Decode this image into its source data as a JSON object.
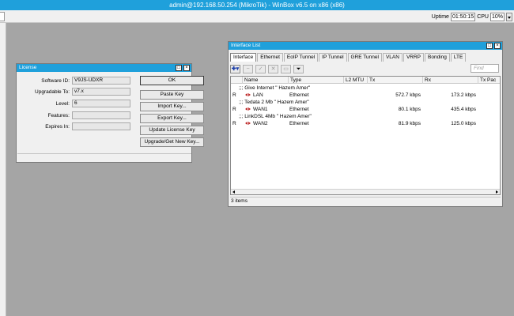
{
  "window": {
    "title": "admin@192.168.50.254 (MikroTik) - WinBox v6.5 on x86 (x86)"
  },
  "status": {
    "uptime_label": "Uptime",
    "uptime_value": "01:50:15",
    "cpu_label": "CPU",
    "cpu_value": "10%"
  },
  "license": {
    "title": "License",
    "fields": [
      {
        "label": "Software ID:",
        "value": "V9JS-UDXR"
      },
      {
        "label": "Upgradable To:",
        "value": "v7.x"
      },
      {
        "label": "Level:",
        "value": "6"
      },
      {
        "label": "Features:",
        "value": ""
      },
      {
        "label": "Expires In:",
        "value": ""
      }
    ],
    "buttons": {
      "ok": "OK",
      "paste": "Paste Key",
      "import": "Import Key...",
      "export": "Export Key...",
      "update": "Update License Key",
      "upgrade": "Upgrade/Get New Key..."
    }
  },
  "interface_list": {
    "title": "Interface List",
    "tabs": [
      "Interface",
      "Ethernet",
      "EoIP Tunnel",
      "IP Tunnel",
      "GRE Tunnel",
      "VLAN",
      "VRRP",
      "Bonding",
      "LTE"
    ],
    "find_placeholder": "Find",
    "columns": {
      "name": "Name",
      "type": "Type",
      "l2mtu": "L2 MTU",
      "tx": "Tx",
      "rx": "Rx",
      "txpac": "Tx Pac"
    },
    "rows": [
      {
        "comment": ";;; Give Internet \" Hazem Amer\"",
        "flag": "R",
        "name": "LAN",
        "type": "Ethernet",
        "tx": "572.7 kbps",
        "rx": "173.2 kbps"
      },
      {
        "comment": ";;; Tedata 2 Mb \" Hazem Amer\"",
        "flag": "R",
        "name": "WAN1",
        "type": "Ethernet",
        "tx": "80.1 kbps",
        "rx": "435.4 kbps"
      },
      {
        "comment": ";;; LinkDSL 4Mb \" Hazem Amer\"",
        "flag": "R",
        "name": "WAN2",
        "type": "Ethernet",
        "tx": "81.9 kbps",
        "rx": "125.0 kbps"
      }
    ],
    "status_text": "3 items"
  },
  "colors": {
    "title_bar": "#1fa0db",
    "desktop": "#a5a5a5",
    "window_bg": "#f0f0f0"
  }
}
